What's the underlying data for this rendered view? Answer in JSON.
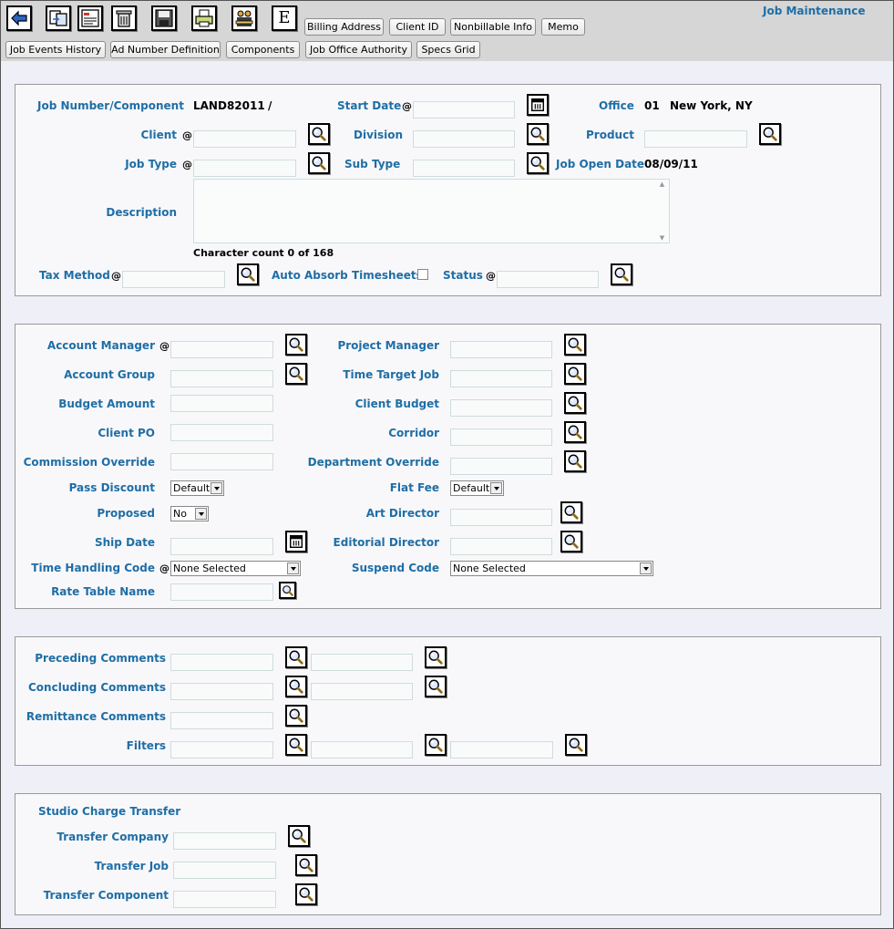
{
  "window": {
    "title": "Job Maintenance"
  },
  "toolbar": {
    "icons": [
      "back-arrow-icon",
      "copy-job-icon",
      "report-icon",
      "delete-trash-icon",
      "save-disk-icon",
      "print-icon",
      "people-icon",
      "e-icon"
    ],
    "e_label": "E",
    "row1_buttons": [
      "Billing Address",
      "Client ID",
      "Nonbillable Info",
      "Memo"
    ],
    "row2_buttons": [
      "Job Events History",
      "Ad Number Definition",
      "Components",
      "Job Office Authority",
      "Specs Grid"
    ]
  },
  "job": {
    "job_number_label": "Job Number/Component",
    "job_number_value": "LAND82011",
    "job_number_sep": "/",
    "start_date_label": "Start Date",
    "office_label": "Office",
    "office_code": "01",
    "office_name": "New York, NY",
    "client_label": "Client",
    "division_label": "Division",
    "product_label": "Product",
    "job_type_label": "Job Type",
    "sub_type_label": "Sub Type",
    "job_open_date_label": "Job Open Date",
    "job_open_date_value": "08/09/11",
    "description_label": "Description",
    "char_count": "Character count 0 of 168",
    "tax_method_label": "Tax Method",
    "auto_absorb_label": "Auto Absorb Timesheets",
    "auto_absorb_checked": false,
    "status_label": "Status",
    "required_marker": "@"
  },
  "details": {
    "account_manager": "Account Manager",
    "project_manager": "Project Manager",
    "account_group": "Account Group",
    "time_target_job": "Time Target Job",
    "budget_amount": "Budget Amount",
    "client_budget": "Client Budget",
    "client_po": "Client PO",
    "corridor": "Corridor",
    "commission_override": "Commission Override",
    "department_override": "Department Override",
    "pass_discount": "Pass Discount",
    "pass_discount_value": "Default",
    "flat_fee": "Flat Fee",
    "flat_fee_value": "Default",
    "proposed": "Proposed",
    "proposed_value": "No",
    "art_director": "Art Director",
    "ship_date": "Ship Date",
    "editorial_director": "Editorial Director",
    "time_handling_code": "Time Handling Code",
    "time_handling_value": "None Selected",
    "suspend_code": "Suspend Code",
    "suspend_value": "None Selected",
    "rate_table_name": "Rate Table Name"
  },
  "comments": {
    "preceding": "Preceding Comments",
    "concluding": "Concluding Comments",
    "remittance": "Remittance Comments",
    "filters": "Filters"
  },
  "studio": {
    "title": "Studio Charge Transfer",
    "transfer_company": "Transfer Company",
    "transfer_job": "Transfer Job",
    "transfer_component": "Transfer Component"
  }
}
